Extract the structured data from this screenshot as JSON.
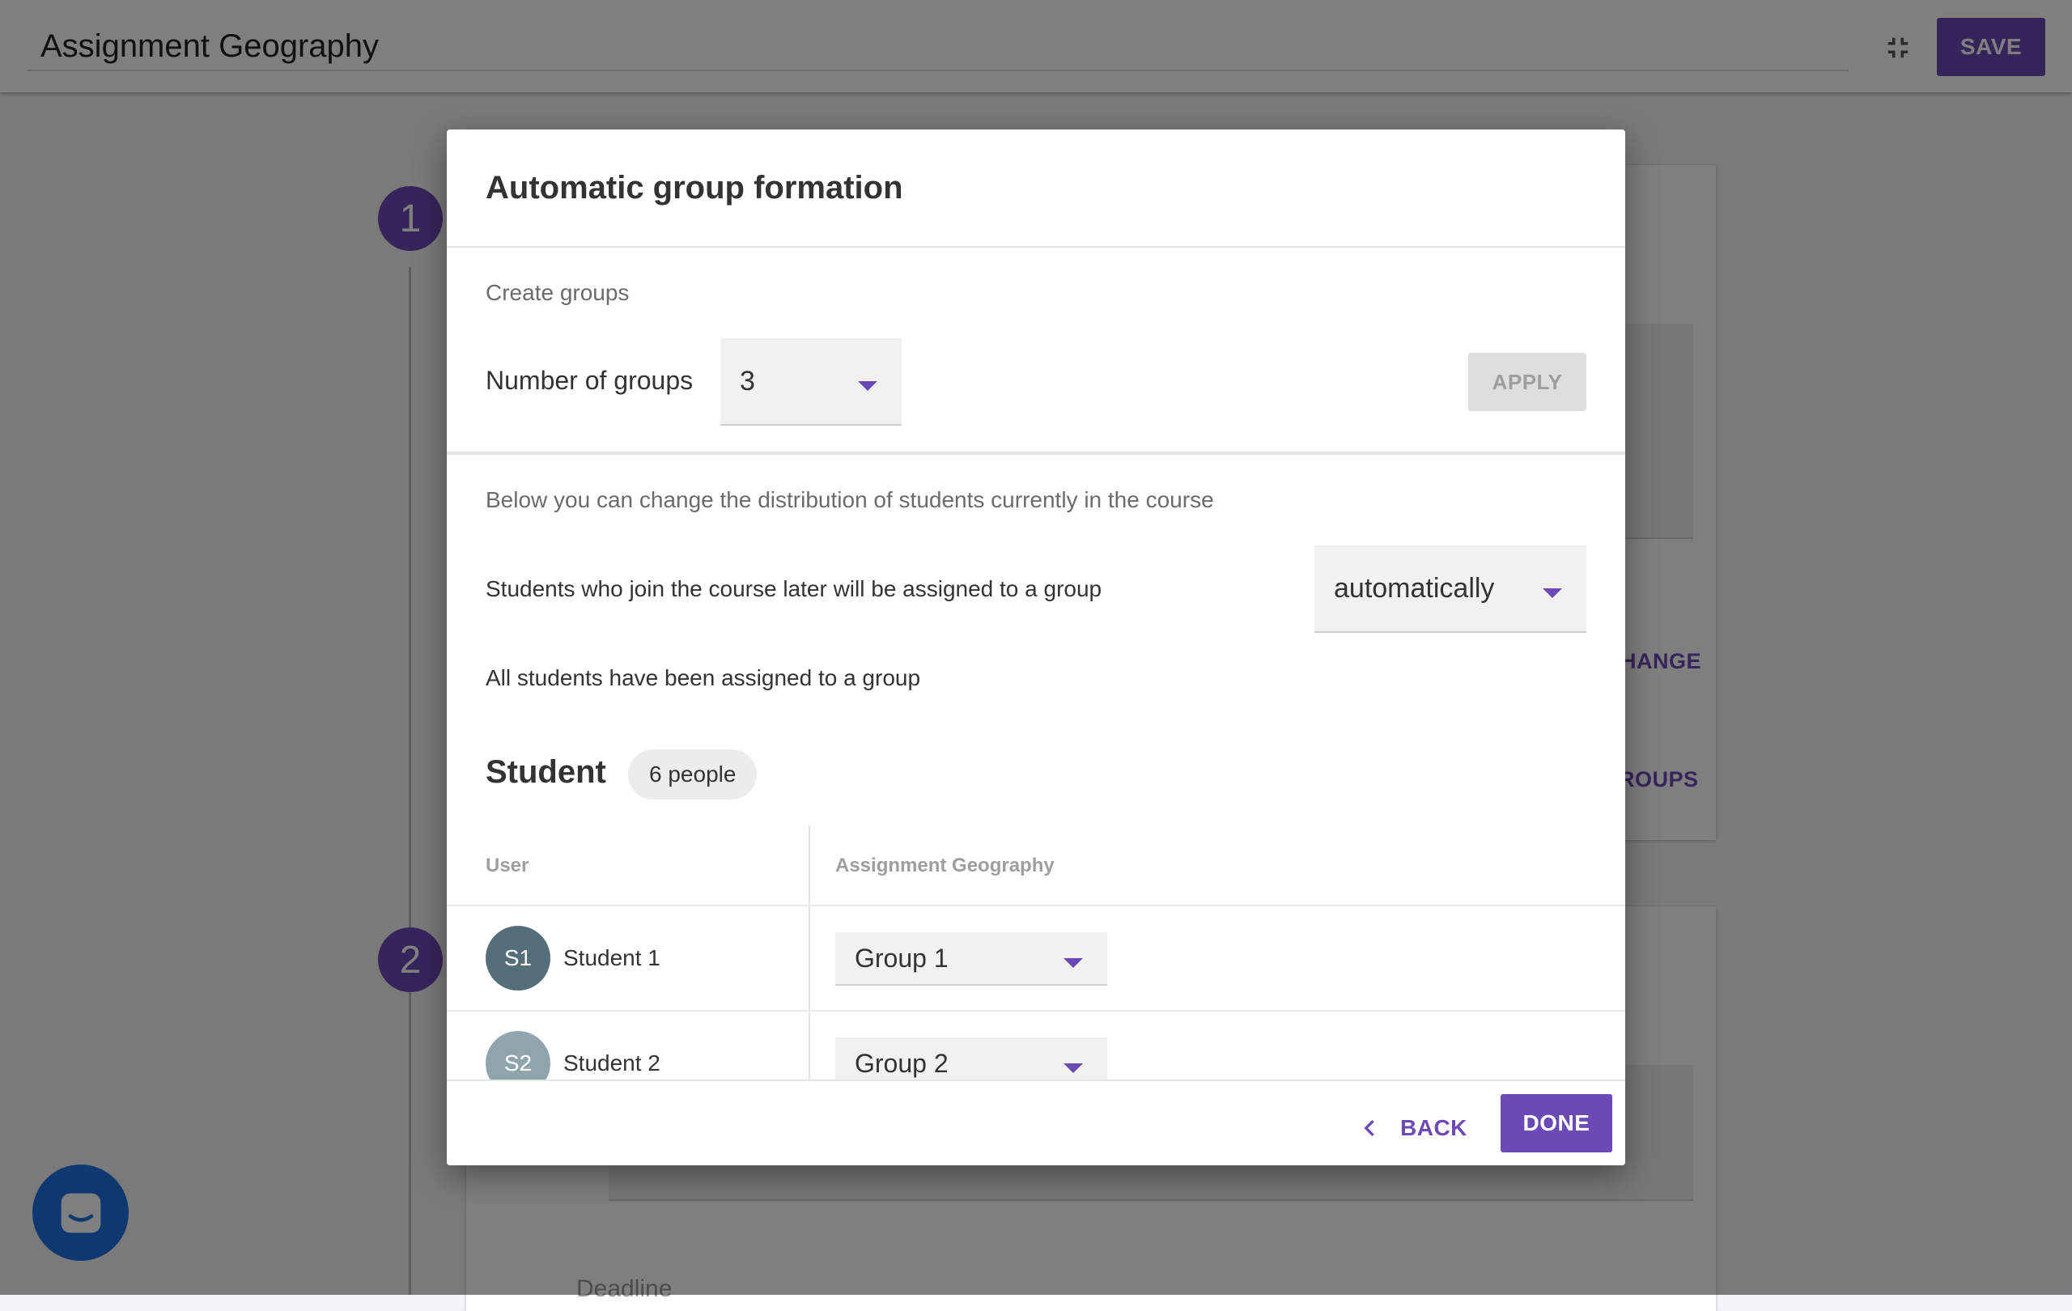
{
  "page": {
    "title": "Assignment Geography",
    "save_label": "SAVE",
    "steps": [
      "1",
      "2"
    ],
    "behind_links": [
      "HANGE",
      "ROUPS"
    ],
    "deadline_placeholder": "Deadline"
  },
  "dialog": {
    "title": "Automatic group formation",
    "create_groups_label": "Create groups",
    "number_of_groups_label": "Number of groups",
    "number_of_groups_value": "3",
    "apply_label": "APPLY",
    "distribution_note": "Below you can change the distribution of students currently in the course",
    "late_join_label": "Students who join the course later will be assigned to a group",
    "late_join_value": "automatically",
    "status_text": "All students have been assigned to a group",
    "role_heading": "Student",
    "people_count": "6 people",
    "columns": [
      "User",
      "Assignment Geography"
    ],
    "rows": [
      {
        "initials": "S1",
        "name": "Student 1",
        "group": "Group 1",
        "avatar_color": "#546e7a"
      },
      {
        "initials": "S2",
        "name": "Student 2",
        "group": "Group 2",
        "avatar_color": "#90a4ae"
      }
    ],
    "back_label": "BACK",
    "done_label": "DONE"
  },
  "colors": {
    "accent": "#6c4ab6",
    "chat_button": "#1f6fe0"
  },
  "icons": [
    "collapse-icon",
    "chevron-left-icon",
    "caret-down-icon",
    "chat-icon"
  ]
}
